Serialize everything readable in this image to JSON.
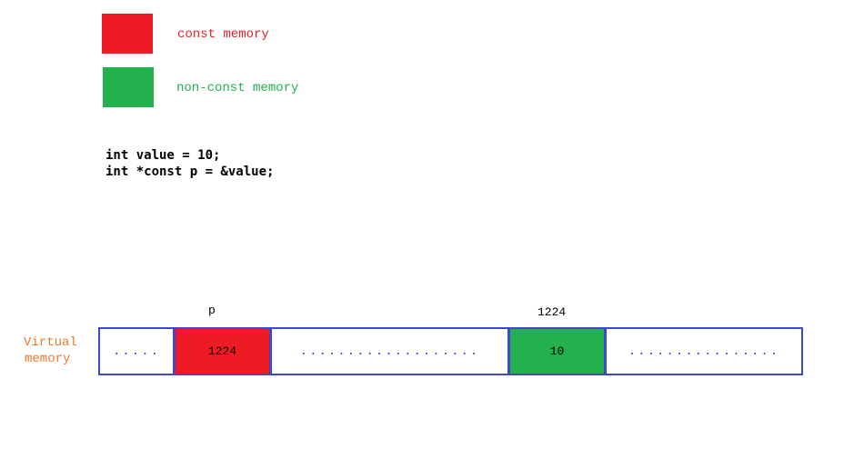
{
  "legend": [
    {
      "label": "const memory",
      "color": "#ed1c24"
    },
    {
      "label": "non-const memory",
      "color": "#22b14c"
    }
  ],
  "code": [
    "int value = 10;",
    "int *const p = &value;"
  ],
  "memory": {
    "label_line1": "Virtual",
    "label_line2": "memory",
    "border_color": "#3f48cc",
    "cells": [
      {
        "text": ".....",
        "kind": "dots"
      },
      {
        "text": "1224",
        "kind": "const",
        "above": "p"
      },
      {
        "text": "...................",
        "kind": "dots"
      },
      {
        "text": "10",
        "kind": "nonconst",
        "above": "1224"
      },
      {
        "text": "................",
        "kind": "dots"
      }
    ]
  }
}
